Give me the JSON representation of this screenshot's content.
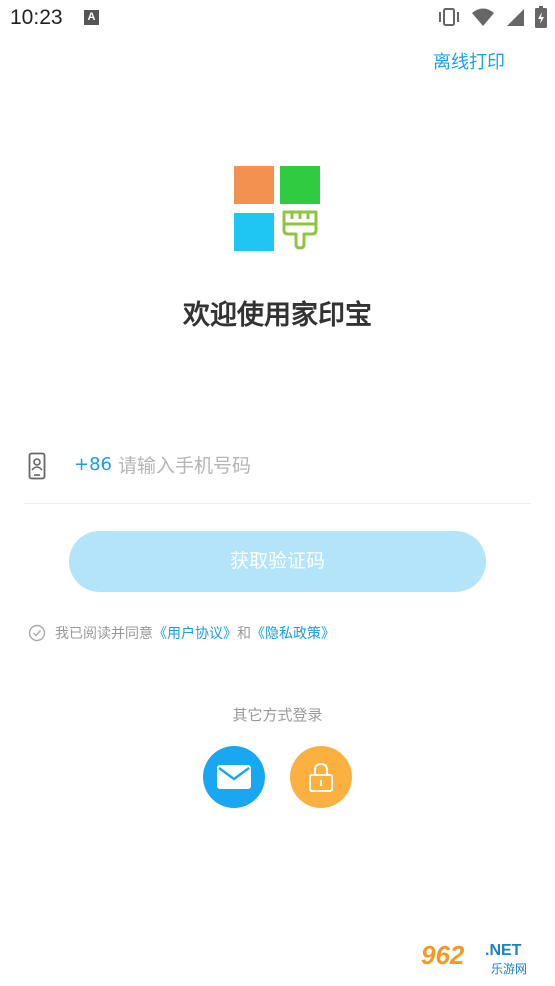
{
  "status_bar": {
    "time": "10:23",
    "notification_letter": "A",
    "icons": [
      "vibrate-icon",
      "wifi-icon",
      "signal-icon",
      "battery-icon"
    ]
  },
  "header": {
    "offline_print_label": "离线打印"
  },
  "logo": {
    "colors": {
      "orange": "#f29150",
      "green": "#2ecc40",
      "blue": "#1fc6f2",
      "brush": "#8cc63f"
    }
  },
  "welcome_title": "欢迎使用家印宝",
  "phone_login": {
    "country_code": "+86",
    "placeholder": "请输入手机号码",
    "value": ""
  },
  "get_code_button": "获取验证码",
  "agreement": {
    "prefix": "我已阅读并同意",
    "user_agreement": "《用户协议》",
    "and": "和",
    "privacy_policy": "《隐私政策》"
  },
  "other_login": {
    "label": "其它方式登录",
    "methods": [
      "email-icon",
      "lock-icon"
    ]
  },
  "watermark": {
    "number": "962",
    "suffix": ".NET",
    "name": "乐游网"
  },
  "colors": {
    "accent": "#1a9ee0",
    "button_disabled": "#b3e4fa",
    "email": "#18a7f0",
    "lock": "#fcb040"
  }
}
